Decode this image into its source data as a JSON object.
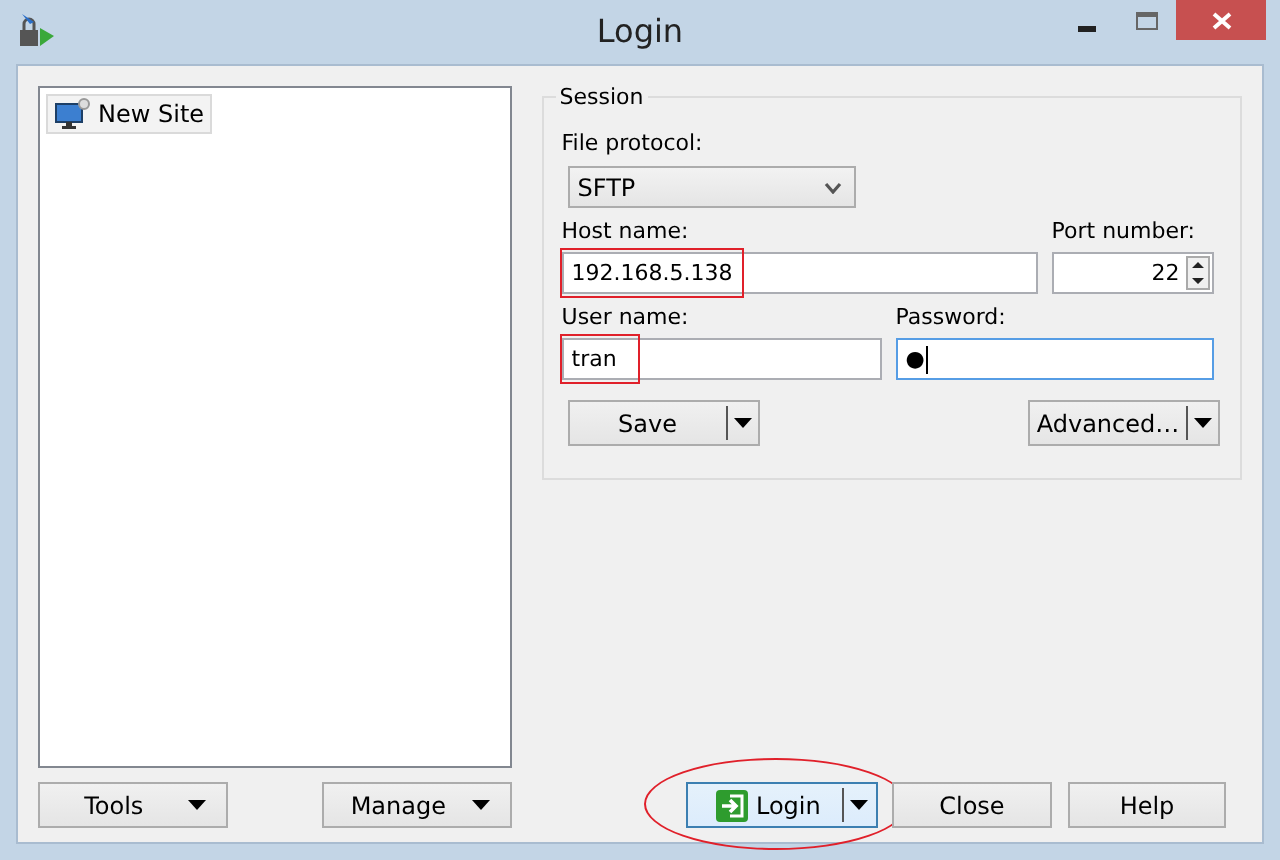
{
  "window": {
    "title": "Login"
  },
  "sites": [
    {
      "label": "New Site",
      "selected": true
    }
  ],
  "session": {
    "title": "Session",
    "file_protocol": {
      "label": "File protocol:",
      "value": "SFTP"
    },
    "host_name": {
      "label": "Host name:",
      "value": "192.168.5.138",
      "highlighted": true
    },
    "port_number": {
      "label": "Port number:",
      "value": "22"
    },
    "user_name": {
      "label": "User name:",
      "value": "tran",
      "highlighted": true
    },
    "password": {
      "label": "Password:",
      "value": "●",
      "focused": true
    },
    "buttons": [
      {
        "label": "Save"
      },
      {
        "label": "Advanced…"
      }
    ]
  },
  "left_buttons": [
    {
      "label": "Tools"
    },
    {
      "label": "Manage"
    }
  ],
  "dialog_buttons": [
    {
      "label": "Login",
      "kind": "split",
      "highlighted": true
    },
    {
      "label": "Close",
      "kind": "plain",
      "highlighted": false
    },
    {
      "label": "Help",
      "kind": "plain",
      "highlighted": false
    }
  ]
}
